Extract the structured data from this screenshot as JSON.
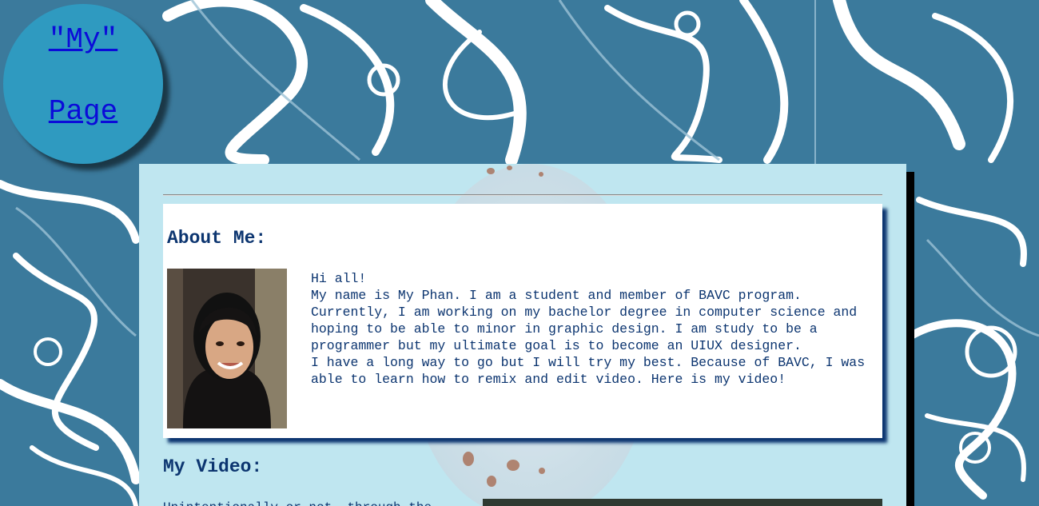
{
  "logo": {
    "line1": "\"My\"",
    "line2": "Page"
  },
  "about": {
    "title": "About Me:",
    "photo_alt": "portrait photo",
    "text": "Hi all!\nMy name is My Phan. I am a student and member of BAVC program. Currently, I am working on my bachelor degree in computer science and hoping to be able to minor in graphic design. I am study to be a programmer but my ultimate goal is to become an UIUX designer.\nI have a long way to go but I will try my best. Because of BAVC, I was able to learn how to remix and edit video. Here is my video!"
  },
  "video": {
    "title": "My Video:",
    "description": "Unintentionally or not, through the"
  },
  "colors": {
    "background": "#3b7a9c",
    "logo_circle": "#2f9ac0",
    "link": "#0b0bd9",
    "heading": "#0c3570",
    "content_panel": "#bfe6f0",
    "card_shadow": "#0c3570"
  }
}
